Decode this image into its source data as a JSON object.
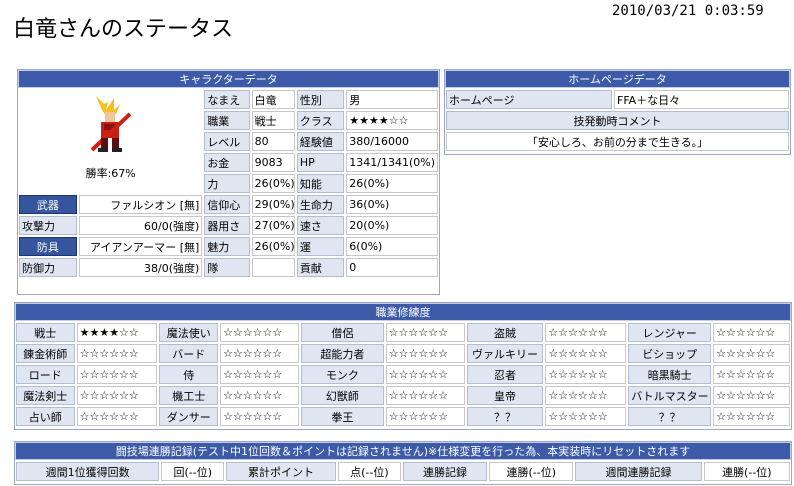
{
  "page": {
    "title": "白竜さんのステータス",
    "timestamp": "2010/03/21  0:03:59"
  },
  "character": {
    "header": "キャラクターデータ",
    "win_rate": "勝率:67%",
    "rows": [
      {
        "l1": "なまえ",
        "v1": "白竜",
        "l2": "性別",
        "v2": "男"
      },
      {
        "l1": "職業",
        "v1": "戦士",
        "l2": "クラス",
        "v2": "★★★★☆☆"
      },
      {
        "l1": "レベル",
        "v1": "80",
        "l2": "経験値",
        "v2": "380/16000"
      },
      {
        "l1": "お金",
        "v1": "9083",
        "l2": "HP",
        "v2": "1341/1341(0%)"
      },
      {
        "l1": "力",
        "v1": "26(0%)",
        "l2": "知能",
        "v2": "26(0%)"
      }
    ],
    "equip_rows": [
      {
        "a": "武器",
        "b": "ファルシオン [無]",
        "l1": "信仰心",
        "v1": "29(0%)",
        "l2": "生命力",
        "v2": "36(0%)"
      },
      {
        "a": "攻撃力",
        "b": "60/0(強度)",
        "l1": "器用さ",
        "v1": "27(0%)",
        "l2": "速さ",
        "v2": "20(0%)"
      },
      {
        "a": "防具",
        "b": "アイアンアーマー [無]",
        "l1": "魅力",
        "v1": "26(0%)",
        "l2": "運",
        "v2": "6(0%)"
      },
      {
        "a": "防御力",
        "b": "38/0(強度)",
        "l1": "隊",
        "v1": "",
        "l2": "貢献",
        "v2": "0"
      }
    ]
  },
  "homepage": {
    "header": "ホームページデータ",
    "label": "ホームページ",
    "value": "FFA＋な日々",
    "comment_label": "技発動時コメント",
    "comment": "「安心しろ、お前の分まで生きる。」"
  },
  "jobs": {
    "header": "職業修練度",
    "rows": [
      [
        "戦士",
        "★★★★☆☆",
        "魔法使い",
        "☆☆☆☆☆☆",
        "僧侶",
        "☆☆☆☆☆☆",
        "盗賊",
        "☆☆☆☆☆☆",
        "レンジャー",
        "☆☆☆☆☆☆"
      ],
      [
        "錬金術師",
        "☆☆☆☆☆☆",
        "バード",
        "☆☆☆☆☆☆",
        "超能力者",
        "☆☆☆☆☆☆",
        "ヴァルキリー",
        "☆☆☆☆☆☆",
        "ビショップ",
        "☆☆☆☆☆☆"
      ],
      [
        "ロード",
        "☆☆☆☆☆☆",
        "侍",
        "☆☆☆☆☆☆",
        "モンク",
        "☆☆☆☆☆☆",
        "忍者",
        "☆☆☆☆☆☆",
        "暗黒騎士",
        "☆☆☆☆☆☆"
      ],
      [
        "魔法剣士",
        "☆☆☆☆☆☆",
        "機工士",
        "☆☆☆☆☆☆",
        "幻獣師",
        "☆☆☆☆☆☆",
        "皇帝",
        "☆☆☆☆☆☆",
        "バトルマスター",
        "☆☆☆☆☆☆"
      ],
      [
        "占い師",
        "☆☆☆☆☆☆",
        "ダンサー",
        "☆☆☆☆☆☆",
        "拳王",
        "☆☆☆☆☆☆",
        "？？",
        "☆☆☆☆☆☆",
        "？？",
        "☆☆☆☆☆☆"
      ]
    ]
  },
  "arena": {
    "header": "闘技場連勝記録(テスト中1位回数＆ポイントは記録されません)※仕様変更を行った為、本実装時にリセットされます",
    "cells": [
      "週間1位獲得回数",
      "回(--位)",
      "累計ポイント",
      "点(--位)",
      "連勝記録",
      "連勝(--位)",
      "週間連勝記録",
      "連勝(--位)"
    ]
  },
  "icons": {
    "avatar": "warrior-sprite-icon"
  },
  "colors": {
    "header_bg": "#3c5aa8",
    "label_bg": "#dfe6f2",
    "button_bg": "#35559e"
  }
}
